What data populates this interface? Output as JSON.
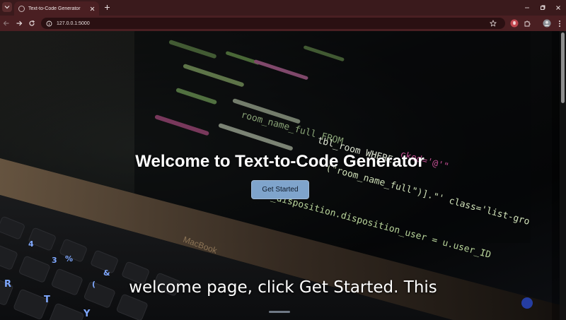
{
  "browser": {
    "tab": {
      "title": "Text-to-Code Generator"
    },
    "address_bar": {
      "url": "127.0.0.1:5000"
    }
  },
  "page": {
    "heading": "Welcome to Text-to-Code Generator",
    "cta_label": "Get Started"
  },
  "background_art": {
    "code_lines": [
      "tbl_room WHERE",
      "(\"room_name_full\")].\"' class='list-gro",
      "tbl_disposition.disposition_user = u.user_ID",
      "room_name_full FROM",
      "cked='@'\""
    ],
    "laptop_brand": "MacBook",
    "key_glyphs": [
      "4",
      "3",
      "%",
      "&",
      "R",
      "T",
      "(",
      "Y"
    ]
  },
  "overlay": {
    "caption": "welcome page, click Get Started. This"
  },
  "colors": {
    "tabstrip_bg": "#3a1a1c",
    "toolbar_bg": "#4a1f22",
    "button_bg": "#7fa4cc",
    "key_backlight": "#7fa8ff",
    "code_green": "#9fd07a",
    "code_magenta": "#e05aa8"
  }
}
